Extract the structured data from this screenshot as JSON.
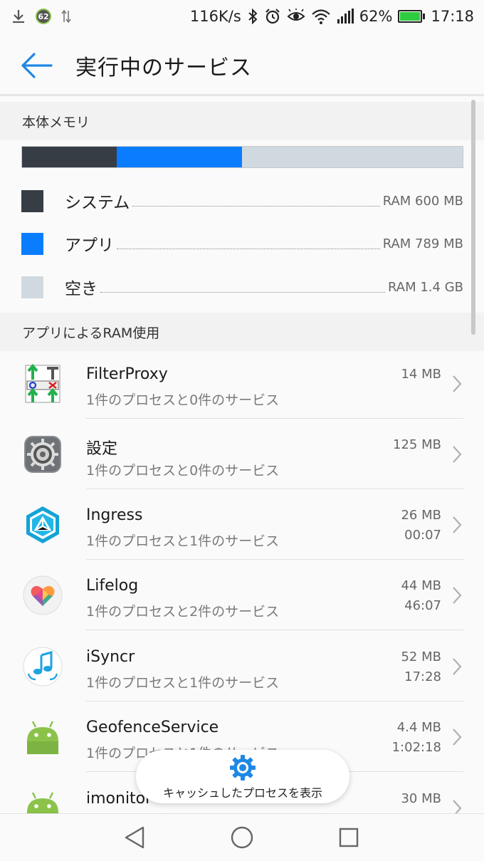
{
  "status_bar": {
    "notif_badge": "62",
    "net_speed": "116K/s",
    "battery": "62%",
    "time": "17:18",
    "icons": [
      "download-icon",
      "notification-badge-icon",
      "data-arrows-icon",
      "bluetooth-icon",
      "alarm-icon",
      "eye-icon",
      "wifi-icon",
      "signal-icon",
      "battery-icon"
    ]
  },
  "app_bar": {
    "title": "実行中のサービス",
    "back_icon": "back-arrow-icon"
  },
  "memory": {
    "header": "本体メモリ",
    "segments": [
      {
        "name": "system",
        "fraction": 0.215,
        "color": "#363d45"
      },
      {
        "name": "app",
        "fraction": 0.285,
        "color": "#0a7dff"
      },
      {
        "name": "free",
        "fraction": 0.5,
        "color": "#d1d9e0"
      }
    ],
    "legend": [
      {
        "label": "システム",
        "value": "RAM 600 MB",
        "color": "#363d45"
      },
      {
        "label": "アプリ",
        "value": "RAM 789 MB",
        "color": "#0a7dff"
      },
      {
        "label": "空き",
        "value": "RAM 1.4 GB",
        "color": "#d1d9e0"
      }
    ]
  },
  "apps": {
    "header": "アプリによるRAM使用",
    "items": [
      {
        "name": "FilterProxy",
        "sub": "1件のプロセスと0件のサービス",
        "size": "14 MB",
        "time": ""
      },
      {
        "name": "設定",
        "sub": "1件のプロセスと0件のサービス",
        "size": "125 MB",
        "time": ""
      },
      {
        "name": "Ingress",
        "sub": "1件のプロセスと1件のサービス",
        "size": "26 MB",
        "time": "00:07"
      },
      {
        "name": "Lifelog",
        "sub": "1件のプロセスと2件のサービス",
        "size": "44 MB",
        "time": "46:07"
      },
      {
        "name": "iSyncr",
        "sub": "1件のプロセスと1件のサービス",
        "size": "52 MB",
        "time": "17:28"
      },
      {
        "name": "GeofenceService",
        "sub": "1件のプロセスと1件のサービス",
        "size": "4.4 MB",
        "time": "1:02:18"
      },
      {
        "name": "imonitor",
        "sub": "",
        "size": "30 MB",
        "time": ""
      }
    ]
  },
  "cached_button": {
    "label": "キャッシュしたプロセスを表示"
  },
  "accent_color": "#1e88e5"
}
